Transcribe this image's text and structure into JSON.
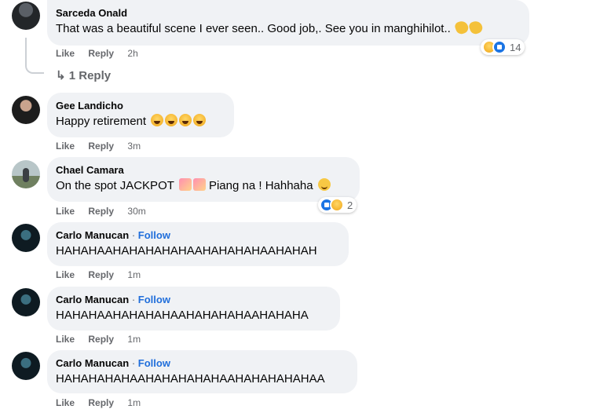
{
  "comments": [
    {
      "author": "Sarceda Onald",
      "text": "That was a beautiful scene I ever seen.. Good job,. See you in manghihilot..",
      "like_label": "Like",
      "reply_label": "Reply",
      "time": "2h",
      "reaction_count": "14",
      "reaction_icons": [
        "haha-icon",
        "like-icon"
      ],
      "trailing_emojis": [
        "clapping-hands-icon",
        "clapping-hands-icon"
      ]
    },
    {
      "author": "Gee Landicho",
      "text": "Happy retirement",
      "like_label": "Like",
      "reply_label": "Reply",
      "time": "3m",
      "trailing_emojis": [
        "rolling-laughing-icon",
        "rolling-laughing-icon",
        "rolling-laughing-icon",
        "rolling-laughing-icon"
      ]
    },
    {
      "author": "Chael Camara",
      "text_before": "On the spot JACKPOT",
      "text_after": "Piang na ! Hahhaha",
      "like_label": "Like",
      "reply_label": "Reply",
      "time": "30m",
      "reaction_count": "2",
      "reaction_icons": [
        "like-icon",
        "haha-icon"
      ]
    },
    {
      "author": "Carlo Manucan",
      "separator": "·",
      "follow_label": "Follow",
      "text": "HAHAHAAHAHAHAHAHAAHAHAHAHAAHAHAH",
      "like_label": "Like",
      "reply_label": "Reply",
      "time": "1m"
    },
    {
      "author": "Carlo Manucan",
      "separator": "·",
      "follow_label": "Follow",
      "text": "HAHAHAAHAHAHAHAAHAHAHAHAAHAHAHA",
      "like_label": "Like",
      "reply_label": "Reply",
      "time": "1m"
    },
    {
      "author": "Carlo Manucan",
      "separator": "·",
      "follow_label": "Follow",
      "text": "HAHAHAHAHAAHAHAHAHAHAAHAHAHAHAHAA",
      "like_label": "Like",
      "reply_label": "Reply",
      "time": "1m"
    }
  ],
  "replies_label": "1 Reply",
  "colors": {
    "bubble": "#f0f2f5",
    "meta": "#65676b",
    "follow": "#216fdb",
    "like_blue": "#1b74e4"
  }
}
